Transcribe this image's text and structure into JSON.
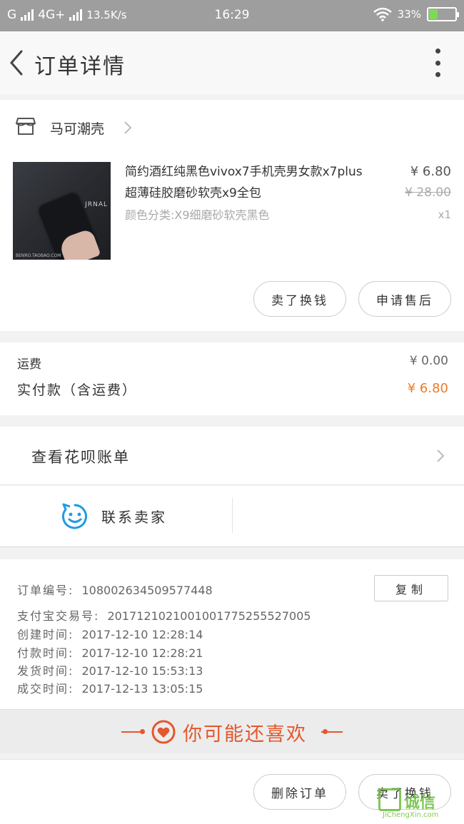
{
  "status_bar": {
    "carrier1": "G",
    "carrier2": "4G+",
    "speed": "13.5K/s",
    "time": "16:29",
    "battery": "33%"
  },
  "nav": {
    "title": "订单详情"
  },
  "shop": {
    "name": "马可潮壳"
  },
  "product": {
    "name": "简约酒红纯黑色vivox7手机壳男女款x7plus超薄硅胶磨砂软壳x9全包",
    "spec": "颜色分类:X9细磨砂软壳黑色",
    "price": "¥ 6.80",
    "original_price": "¥ 28.00",
    "quantity": "x1",
    "image_label": "JRNAL",
    "image_caption": "BENRO.TAOBAO.COM",
    "buttons": [
      "卖了换钱",
      "申请售后"
    ]
  },
  "fees": {
    "shipping_label": "运费",
    "shipping_value": "¥ 0.00",
    "paid_label": "实付款（含运费）",
    "paid_value": "¥ 6.80"
  },
  "huabei": {
    "label": "查看花呗账单"
  },
  "contact": {
    "label": "联系卖家"
  },
  "order_info": {
    "copy_label": "复制",
    "rows": [
      {
        "key": "订单编号:",
        "value": "108002634509577448"
      },
      {
        "key": "支付宝交易号:",
        "value": "2017121021001001775255527005"
      },
      {
        "key": "创建时间:",
        "value": "2017-12-10 12:28:14"
      },
      {
        "key": "付款时间:",
        "value": "2017-12-10 12:28:21"
      },
      {
        "key": "发货时间:",
        "value": "2017-12-10 15:53:13"
      },
      {
        "key": "成交时间:",
        "value": "2017-12-13 13:05:15"
      }
    ]
  },
  "recommend": {
    "label": "你可能还喜欢"
  },
  "bottom": {
    "buttons": [
      "删除订单",
      "卖了换钱"
    ]
  },
  "watermark": {
    "big": "诚信",
    "small": "JiChengXin.com"
  },
  "colors": {
    "accent": "#f07a2a",
    "recommend": "#e4572e",
    "contact_icon": "#1e9be6"
  }
}
